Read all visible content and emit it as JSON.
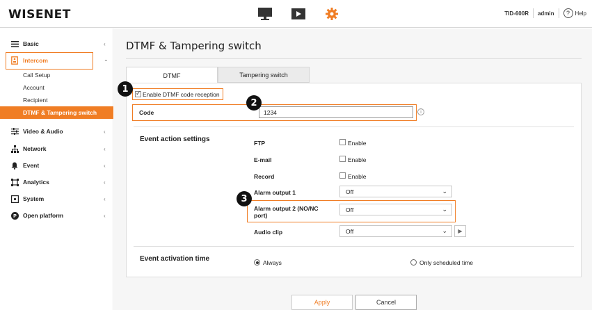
{
  "header": {
    "logo": "WISENET",
    "model": "TID-600R",
    "user": "admin",
    "help": "Help",
    "icons": [
      "monitor-icon",
      "playback-icon",
      "settings-gear-icon"
    ],
    "accent": "#f07d24"
  },
  "sidebar": {
    "items": [
      {
        "label": "Basic",
        "icon": "list-icon",
        "chevron": "‹"
      },
      {
        "label": "Intercom",
        "icon": "intercom-icon",
        "chevron": "⌄"
      },
      {
        "label": "Video & Audio",
        "icon": "sliders-icon",
        "chevron": "‹"
      },
      {
        "label": "Network",
        "icon": "network-icon",
        "chevron": "‹"
      },
      {
        "label": "Event",
        "icon": "bell-icon",
        "chevron": "‹"
      },
      {
        "label": "Analytics",
        "icon": "analytics-icon",
        "chevron": "‹"
      },
      {
        "label": "System",
        "icon": "system-icon",
        "chevron": "‹"
      },
      {
        "label": "Open platform",
        "icon": "open-platform-icon",
        "chevron": "‹"
      }
    ],
    "intercom_sub": [
      "Call Setup",
      "Account",
      "Recipient",
      "DTMF & Tampering switch"
    ]
  },
  "main": {
    "title": "DTMF & Tampering switch",
    "tabs": [
      "DTMF",
      "Tampering switch"
    ],
    "enable_dtmf_label": "Enable DTMF code reception",
    "code_label": "Code",
    "code_value": "1234",
    "event_action_title": "Event action settings",
    "actions": {
      "ftp": "FTP",
      "email": "E-mail",
      "record": "Record",
      "enable": "Enable",
      "alarm1": "Alarm output 1",
      "alarm2": "Alarm output 2 (NO/NC port)",
      "audio_clip": "Audio clip",
      "off": "Off"
    },
    "activation_title": "Event activation time",
    "always": "Always",
    "scheduled": "Only scheduled time",
    "apply": "Apply",
    "cancel": "Cancel"
  },
  "callouts": [
    "1",
    "2",
    "3"
  ]
}
